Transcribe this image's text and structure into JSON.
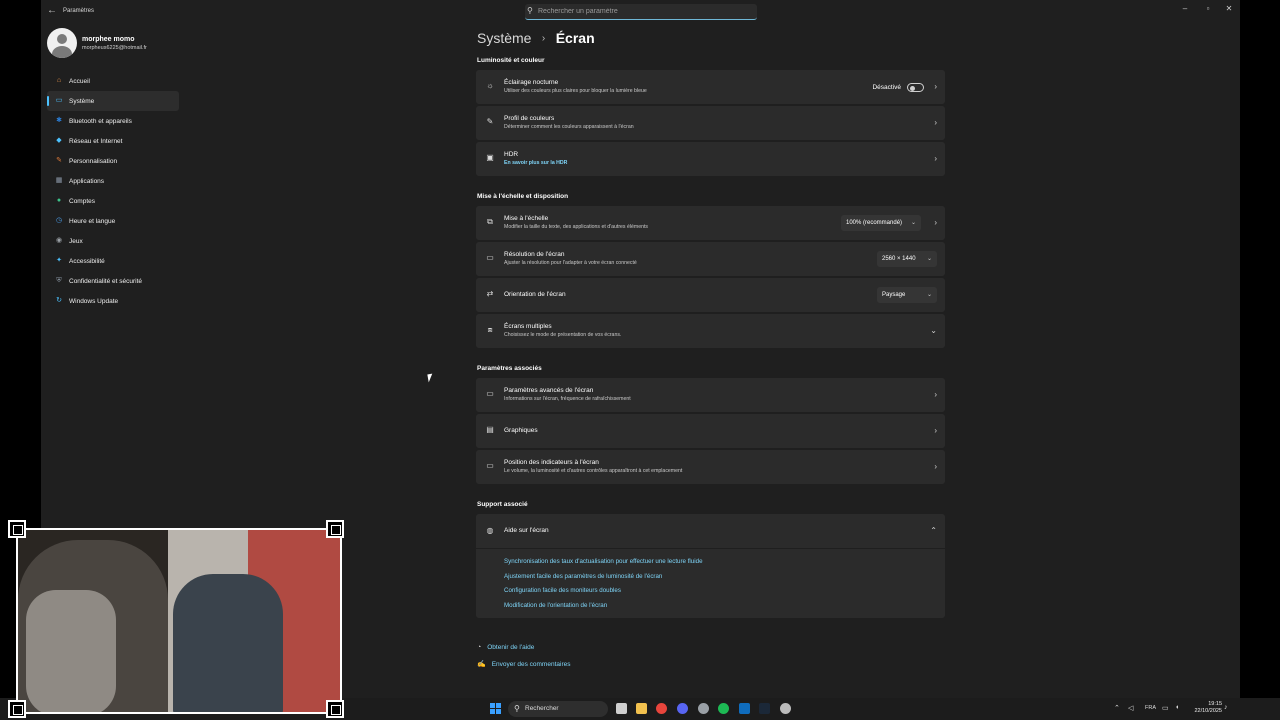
{
  "window": {
    "title": "Paramètres",
    "controls": {
      "minimize": "–",
      "maximize": "▫",
      "close": "✕"
    }
  },
  "search": {
    "placeholder": "Rechercher un paramètre"
  },
  "user": {
    "name": "morphee momo",
    "email": "morpheus6225@hotmail.fr"
  },
  "nav": {
    "items": [
      {
        "label": "Accueil",
        "icon": "home-icon",
        "color": "#e8944a",
        "glyph": "⌂"
      },
      {
        "label": "Système",
        "icon": "system-icon",
        "color": "#4cc2ff",
        "glyph": "▭"
      },
      {
        "label": "Bluetooth et appareils",
        "icon": "bluetooth-icon",
        "color": "#2b7fd8",
        "glyph": "✱"
      },
      {
        "label": "Réseau et Internet",
        "icon": "wifi-icon",
        "color": "#4cc2ff",
        "glyph": "◆"
      },
      {
        "label": "Personnalisation",
        "icon": "brush-icon",
        "color": "#e07b39",
        "glyph": "✎"
      },
      {
        "label": "Applications",
        "icon": "apps-icon",
        "color": "#8f9cad",
        "glyph": "▦"
      },
      {
        "label": "Comptes",
        "icon": "accounts-icon",
        "color": "#3cc28a",
        "glyph": "●"
      },
      {
        "label": "Heure et langue",
        "icon": "globe-clock-icon",
        "color": "#4a9ce8",
        "glyph": "◷"
      },
      {
        "label": "Jeux",
        "icon": "gamepad-icon",
        "color": "#9aa0a6",
        "glyph": "◉"
      },
      {
        "label": "Accessibilité",
        "icon": "accessibility-icon",
        "color": "#4cc2ff",
        "glyph": "✦"
      },
      {
        "label": "Confidentialité et sécurité",
        "icon": "shield-icon",
        "color": "#8a96a3",
        "glyph": "⛨"
      },
      {
        "label": "Windows Update",
        "icon": "update-icon",
        "color": "#4cc2ff",
        "glyph": "↻"
      }
    ]
  },
  "breadcrumb": {
    "root": "Système",
    "separator": "›",
    "page": "Écran"
  },
  "sections": {
    "brightness": {
      "title": "Luminosité et couleur"
    },
    "scale": {
      "title": "Mise à l'échelle et disposition"
    },
    "related": {
      "title": "Paramètres associés"
    },
    "support": {
      "title": "Support associé"
    }
  },
  "cards": {
    "night_light": {
      "title": "Éclairage nocturne",
      "subtitle": "Utiliser des couleurs plus claires pour bloquer la lumière bleue",
      "state": "Désactivé",
      "icon": "sun-icon"
    },
    "color_profile": {
      "title": "Profil de couleurs",
      "subtitle": "Déterminer comment les couleurs apparaissent à l'écran",
      "icon": "pen-icon"
    },
    "hdr": {
      "title": "HDR",
      "subtitle": "En savoir plus sur la HDR",
      "icon": "hdr-icon"
    },
    "scaling": {
      "title": "Mise à l'échelle",
      "subtitle": "Modifier la taille du texte, des applications et d'autres éléments",
      "value": "100% (recommandé)",
      "icon": "scale-icon"
    },
    "resolution": {
      "title": "Résolution de l'écran",
      "subtitle": "Ajuster la résolution pour l'adapter à  votre  écran connecté",
      "value": "2560 × 1440",
      "icon": "resolution-icon"
    },
    "orientation": {
      "title": "Orientation de l'écran",
      "value": "Paysage",
      "icon": "orientation-icon"
    },
    "multi_display": {
      "title": "Écrans multiples",
      "subtitle": "Choisissez le mode de présentation de vos écrans.",
      "icon": "multi-monitor-icon"
    },
    "advanced": {
      "title": "Paramètres avancés de l'écran",
      "subtitle": "Informations sur l'écran, fréquence de rafraîchissement",
      "icon": "monitor-icon"
    },
    "graphics": {
      "title": "Graphiques",
      "icon": "graphics-icon"
    },
    "indicators": {
      "title": "Position des indicateurs à l'écran",
      "subtitle": "Le volume, la luminosité et d'autres contrôles apparaîtront à cet emplacement",
      "icon": "indicator-icon"
    },
    "help": {
      "title": "Aide sur l'écran",
      "icon": "globe-icon",
      "links": [
        "Synchronisation des taux d'actualisation pour effectuer une lecture fluide",
        "Ajustement facile des paramètres de luminosité de l'écran",
        "Configuration facile des moniteurs doubles",
        "Modification de l'orientation de l'écran"
      ]
    }
  },
  "footer": {
    "get_help": "Obtenir de l'aide",
    "feedback": "Envoyer des commentaires"
  },
  "taskbar": {
    "search_label": "Rechercher",
    "language": "FRA",
    "time": "19:15",
    "date": "22/10/2025",
    "apps": [
      {
        "icon": "task-view-icon",
        "color": "#cfcfcf"
      },
      {
        "icon": "file-explorer-icon",
        "color": "#f2c14e"
      },
      {
        "icon": "chrome-icon",
        "color": "#e8453c"
      },
      {
        "icon": "discord-icon",
        "color": "#5865f2"
      },
      {
        "icon": "app-icon",
        "color": "#9aa0a6"
      },
      {
        "icon": "spotify-icon",
        "color": "#1db954"
      },
      {
        "icon": "outlook-icon",
        "color": "#0f6cbd"
      },
      {
        "icon": "steam-icon",
        "color": "#1b2838"
      },
      {
        "icon": "settings-icon",
        "color": "#bbbbbb"
      }
    ]
  },
  "colors": {
    "accent": "#4cc2ff",
    "link": "#7fd5f8",
    "card": "#2b2b2b",
    "window": "#1f1f1f"
  }
}
